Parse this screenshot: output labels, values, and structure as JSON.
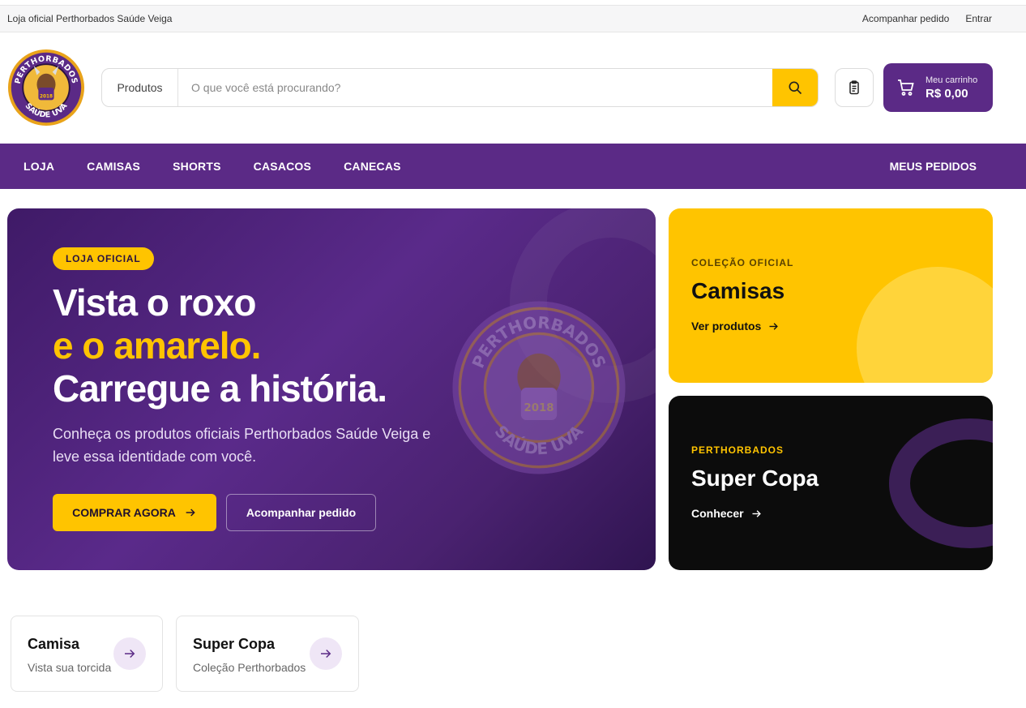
{
  "topbar": {
    "store_name": "Loja oficial Perthorbados Saúde Veiga",
    "track_order": "Acompanhar pedido",
    "login": "Entrar"
  },
  "header": {
    "logo_text_top": "PERTHORBADOS",
    "logo_text_bottom": "SAÚDE UVA",
    "logo_year": "2018",
    "search_category": "Produtos",
    "search_placeholder": "O que você está procurando?",
    "cart_label": "Meu carrinho",
    "cart_value": "R$ 0,00"
  },
  "nav": {
    "items": [
      "LOJA",
      "CAMISAS",
      "SHORTS",
      "CASACOS",
      "CANECAS"
    ],
    "right": "MEUS PEDIDOS"
  },
  "hero": {
    "badge": "LOJA OFICIAL",
    "line1": "Vista o roxo",
    "line2": "e o amarelo.",
    "line3": "Carregue a história.",
    "subtitle": "Conheça os produtos oficiais Perthorbados Saúde Veiga e leve essa identidade com você.",
    "cta_primary": "COMPRAR AGORA",
    "cta_secondary": "Acompanhar pedido"
  },
  "cards": [
    {
      "kicker": "COLEÇÃO OFICIAL",
      "title": "Camisas",
      "link": "Ver produtos"
    },
    {
      "kicker": "PERTHORBADOS",
      "title": "Super Copa",
      "link": "Conhecer"
    }
  ],
  "categories": [
    {
      "title": "Camisa",
      "subtitle": "Vista sua torcida"
    },
    {
      "title": "Super Copa",
      "subtitle": "Coleção Perthorbados"
    }
  ],
  "colors": {
    "purple": "#5b2a86",
    "yellow": "#ffc400",
    "black": "#0c0c0c"
  }
}
